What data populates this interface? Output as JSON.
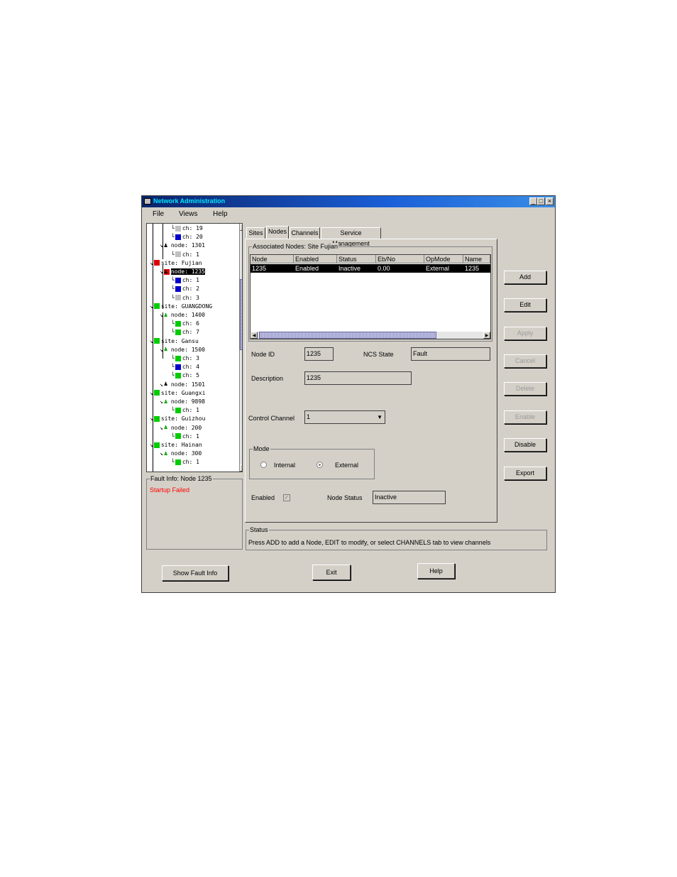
{
  "window": {
    "title": "Network Administration",
    "controls": [
      "_",
      "□",
      "×"
    ]
  },
  "menu": {
    "file": "File",
    "views": "Views",
    "help": "Help"
  },
  "tree": {
    "rows": [
      {
        "text": "ch: 19",
        "icon": "channel-gray",
        "color": "#c0c0c0"
      },
      {
        "text": "ch: 20",
        "icon": "channel-blue",
        "color": "#0000cc"
      },
      {
        "text": "node: 1301",
        "icon": "node-black",
        "color": "#000000"
      },
      {
        "text": "ch: 1",
        "icon": "channel-gray",
        "color": "#c0c0c0"
      },
      {
        "text": "site: Fujian",
        "icon": "site-red",
        "color": "#dd0000"
      },
      {
        "text": "node: 1235",
        "icon": "node-red",
        "color": "#dd0000",
        "selected": true
      },
      {
        "text": "ch: 1",
        "icon": "channel-blue",
        "color": "#0000cc"
      },
      {
        "text": "ch: 2",
        "icon": "channel-blue",
        "color": "#0000cc"
      },
      {
        "text": "ch: 3",
        "icon": "channel-gray",
        "color": "#c0c0c0"
      },
      {
        "text": "site: GUANGDONG",
        "icon": "site-green",
        "color": "#00cc00"
      },
      {
        "text": "node: 1400",
        "icon": "node-green",
        "color": "#00aa00"
      },
      {
        "text": "ch: 6",
        "icon": "channel-green",
        "color": "#00cc00"
      },
      {
        "text": "ch: 7",
        "icon": "channel-green",
        "color": "#00cc00"
      },
      {
        "text": "site: Gansu",
        "icon": "site-green",
        "color": "#00cc00"
      },
      {
        "text": "node: 1500",
        "icon": "node-green",
        "color": "#00aa00"
      },
      {
        "text": "ch: 3",
        "icon": "channel-green",
        "color": "#00cc00"
      },
      {
        "text": "ch: 4",
        "icon": "channel-blue",
        "color": "#0000cc"
      },
      {
        "text": "ch: 5",
        "icon": "channel-green",
        "color": "#00cc00"
      },
      {
        "text": "node: 1501",
        "icon": "node-black",
        "color": "#000000"
      },
      {
        "text": "site: Guangxi",
        "icon": "site-green",
        "color": "#00cc00"
      },
      {
        "text": "node: 9898",
        "icon": "node-green",
        "color": "#00aa00"
      },
      {
        "text": "ch: 1",
        "icon": "channel-green",
        "color": "#00cc00"
      },
      {
        "text": "site: Guizhou",
        "icon": "site-green",
        "color": "#00cc00"
      },
      {
        "text": "node: 200",
        "icon": "node-green",
        "color": "#00aa00"
      },
      {
        "text": "ch: 1",
        "icon": "channel-green",
        "color": "#00cc00"
      },
      {
        "text": "site: Hainan",
        "icon": "site-green",
        "color": "#00cc00"
      },
      {
        "text": "node: 300",
        "icon": "node-green",
        "color": "#00aa00"
      },
      {
        "text": "ch: 1",
        "icon": "channel-green",
        "color": "#00cc00"
      }
    ]
  },
  "fault": {
    "legend": "Fault Info: Node 1235",
    "message": "Startup Failed",
    "message_color": "#ff0000"
  },
  "tabs": [
    "Sites",
    "Nodes",
    "Channels",
    "Service Management"
  ],
  "assoc": {
    "legend": "Associated Nodes: Site Fujian",
    "columns": [
      "Node",
      "Enabled",
      "Status",
      "Eb/No",
      "OpMode",
      "Name"
    ],
    "rows": [
      [
        "1235",
        "Enabled",
        "Inactive",
        "0.00",
        "External",
        "1235"
      ]
    ]
  },
  "form": {
    "node_id_label": "Node ID",
    "node_id": "1235",
    "ncs_state_label": "NCS State",
    "ncs_state": "Fault",
    "description_label": "Description",
    "description": "1235",
    "control_channel_label": "Control Channel",
    "control_channel": "1",
    "mode_legend": "Mode",
    "mode_internal": "Internal",
    "mode_external": "External",
    "enabled_label": "Enabled",
    "enabled_checked": true,
    "node_status_label": "Node Status",
    "node_status": "Inactive"
  },
  "actions": {
    "add": "Add",
    "edit": "Edit",
    "apply": "Apply",
    "cancel": "Cancel",
    "delete": "Delete",
    "enable": "Enable",
    "disable": "Disable",
    "export": "Export"
  },
  "status": {
    "legend": "Status",
    "text": "Press ADD to add a Node, EDIT to modify, or select CHANNELS tab to view channels"
  },
  "bottom": {
    "show_fault": "Show Fault Info",
    "exit": "Exit",
    "help": "Help"
  }
}
